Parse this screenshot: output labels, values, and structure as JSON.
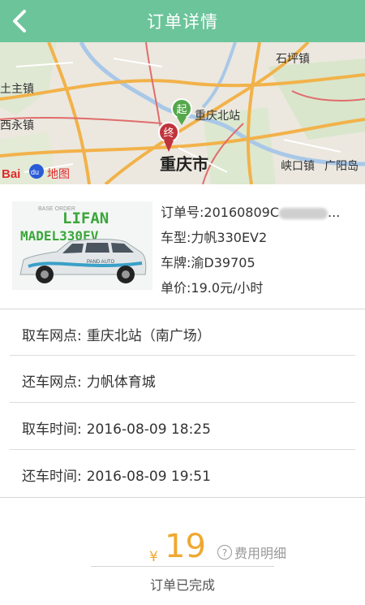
{
  "header": {
    "title": "订单详情",
    "bg_color": "#6cc49a",
    "back_icon": "chevron-left-icon"
  },
  "map": {
    "labels": {
      "shiping": "石坪镇",
      "tuzhen": "土主镇",
      "xiyong": "西永镇",
      "chongqing_north": "重庆北站",
      "chongqing_city": "重庆市",
      "xiakou": "峡口镇",
      "guangyang": "广阳岛"
    },
    "start_marker": "起",
    "end_marker": "终",
    "logo": {
      "bai": "Bai",
      "du": "du",
      "ditu": "地图"
    }
  },
  "car_image": {
    "brand": "LIFAN",
    "model": "MADEL330EV",
    "small_text": "BASE ORDER",
    "side_text": "PAND AUTO"
  },
  "order": {
    "order_no_label": "订单号:",
    "order_no_value": "20160809C",
    "order_no_suffix": "...",
    "car_type_label": "车型:",
    "car_type_value": "力帆330EV2",
    "plate_label": "车牌:",
    "plate_value": "渝D39705",
    "unit_price_label": "单价:",
    "unit_price_value": "19.0元/小时"
  },
  "details": [
    {
      "label": "取车网点:",
      "value": "重庆北站（南广场）"
    },
    {
      "label": "还车网点:",
      "value": "力帆体育城"
    },
    {
      "label": "取车时间:",
      "value": "2016-08-09 18:25"
    },
    {
      "label": "还车时间:",
      "value": "2016-08-09 19:51"
    }
  ],
  "summary": {
    "currency": "¥",
    "amount": "19",
    "fee_detail": "费用明细",
    "help_icon": "question-circle-icon",
    "status": "订单已完成",
    "accent_color": "#f0a830"
  }
}
